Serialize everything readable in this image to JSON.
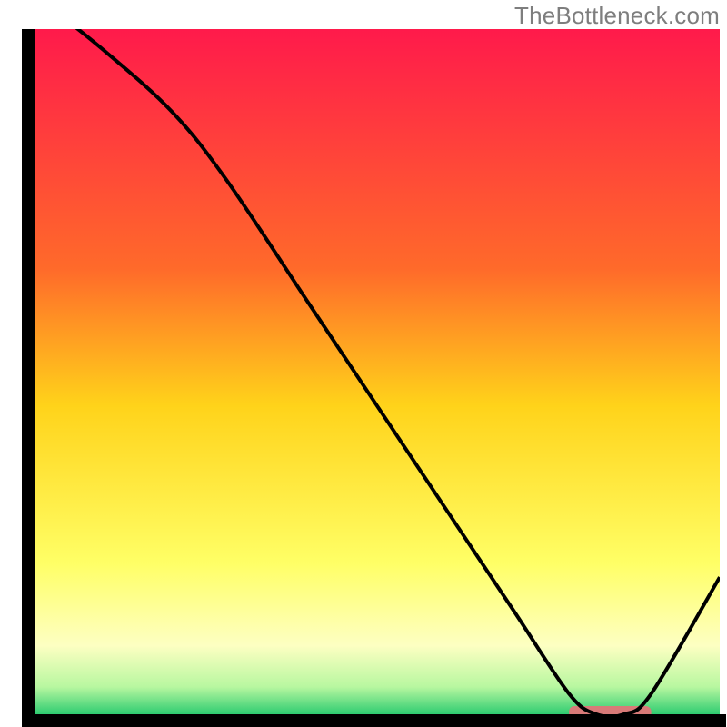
{
  "attribution": "TheBottleneck.com",
  "chart_data": {
    "type": "line",
    "title": "",
    "xlabel": "",
    "ylabel": "",
    "xlim": [
      0,
      100
    ],
    "ylim": [
      0,
      100
    ],
    "x": [
      0,
      10,
      20,
      28,
      40,
      50,
      60,
      70,
      78,
      82,
      86,
      90,
      100
    ],
    "values": [
      105,
      97,
      88,
      78,
      60,
      45,
      30,
      15,
      3,
      0,
      0,
      3,
      20
    ],
    "optimum_band": {
      "x_start": 78,
      "x_end": 90,
      "y": 0
    },
    "gradient_stops": [
      {
        "pct": 0,
        "color": "#ff1a4b"
      },
      {
        "pct": 35,
        "color": "#ff6a2a"
      },
      {
        "pct": 55,
        "color": "#ffd31a"
      },
      {
        "pct": 78,
        "color": "#ffff66"
      },
      {
        "pct": 90,
        "color": "#fdffc2"
      },
      {
        "pct": 96,
        "color": "#b8f7a0"
      },
      {
        "pct": 100,
        "color": "#2ecc71"
      }
    ],
    "marker_color": "#d87a78",
    "curve_color": "#000000"
  }
}
